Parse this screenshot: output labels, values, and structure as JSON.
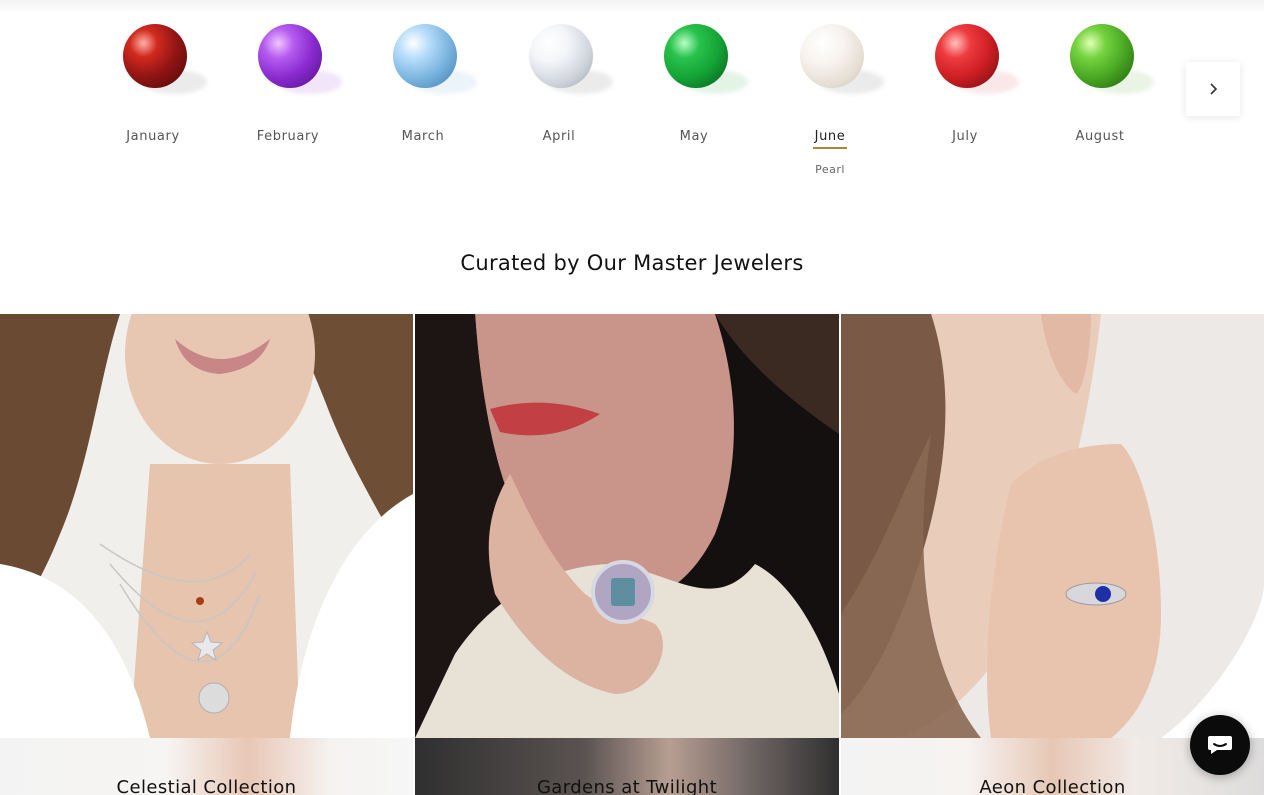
{
  "birthstones": {
    "months": [
      {
        "label": "January",
        "gem_icon": "garnet-gem-icon",
        "color": "#8e1414"
      },
      {
        "label": "February",
        "gem_icon": "amethyst-gem-icon",
        "color": "#8a2bd0"
      },
      {
        "label": "March",
        "gem_icon": "aquamarine-gem-icon",
        "color": "#79b4de"
      },
      {
        "label": "April",
        "gem_icon": "diamond-gem-icon",
        "color": "#e0e4ea"
      },
      {
        "label": "May",
        "gem_icon": "emerald-gem-icon",
        "color": "#15a436"
      },
      {
        "label": "June",
        "gem_icon": "pearl-gem-icon",
        "color": "#f1ece6",
        "active": true,
        "gem_name": "Pearl"
      },
      {
        "label": "July",
        "gem_icon": "ruby-gem-icon",
        "color": "#cc1f24"
      },
      {
        "label": "August",
        "gem_icon": "peridot-gem-icon",
        "color": "#4aa823"
      }
    ],
    "next_icon": "chevron-right-icon",
    "accent_color": "#b58135"
  },
  "curated": {
    "title": "Curated by Our Master Jewelers",
    "collections": [
      {
        "name": "Celestial Collection"
      },
      {
        "name": "Gardens at Twilight"
      },
      {
        "name": "Aeon Collection"
      }
    ]
  },
  "chat": {
    "icon": "chat-icon"
  }
}
